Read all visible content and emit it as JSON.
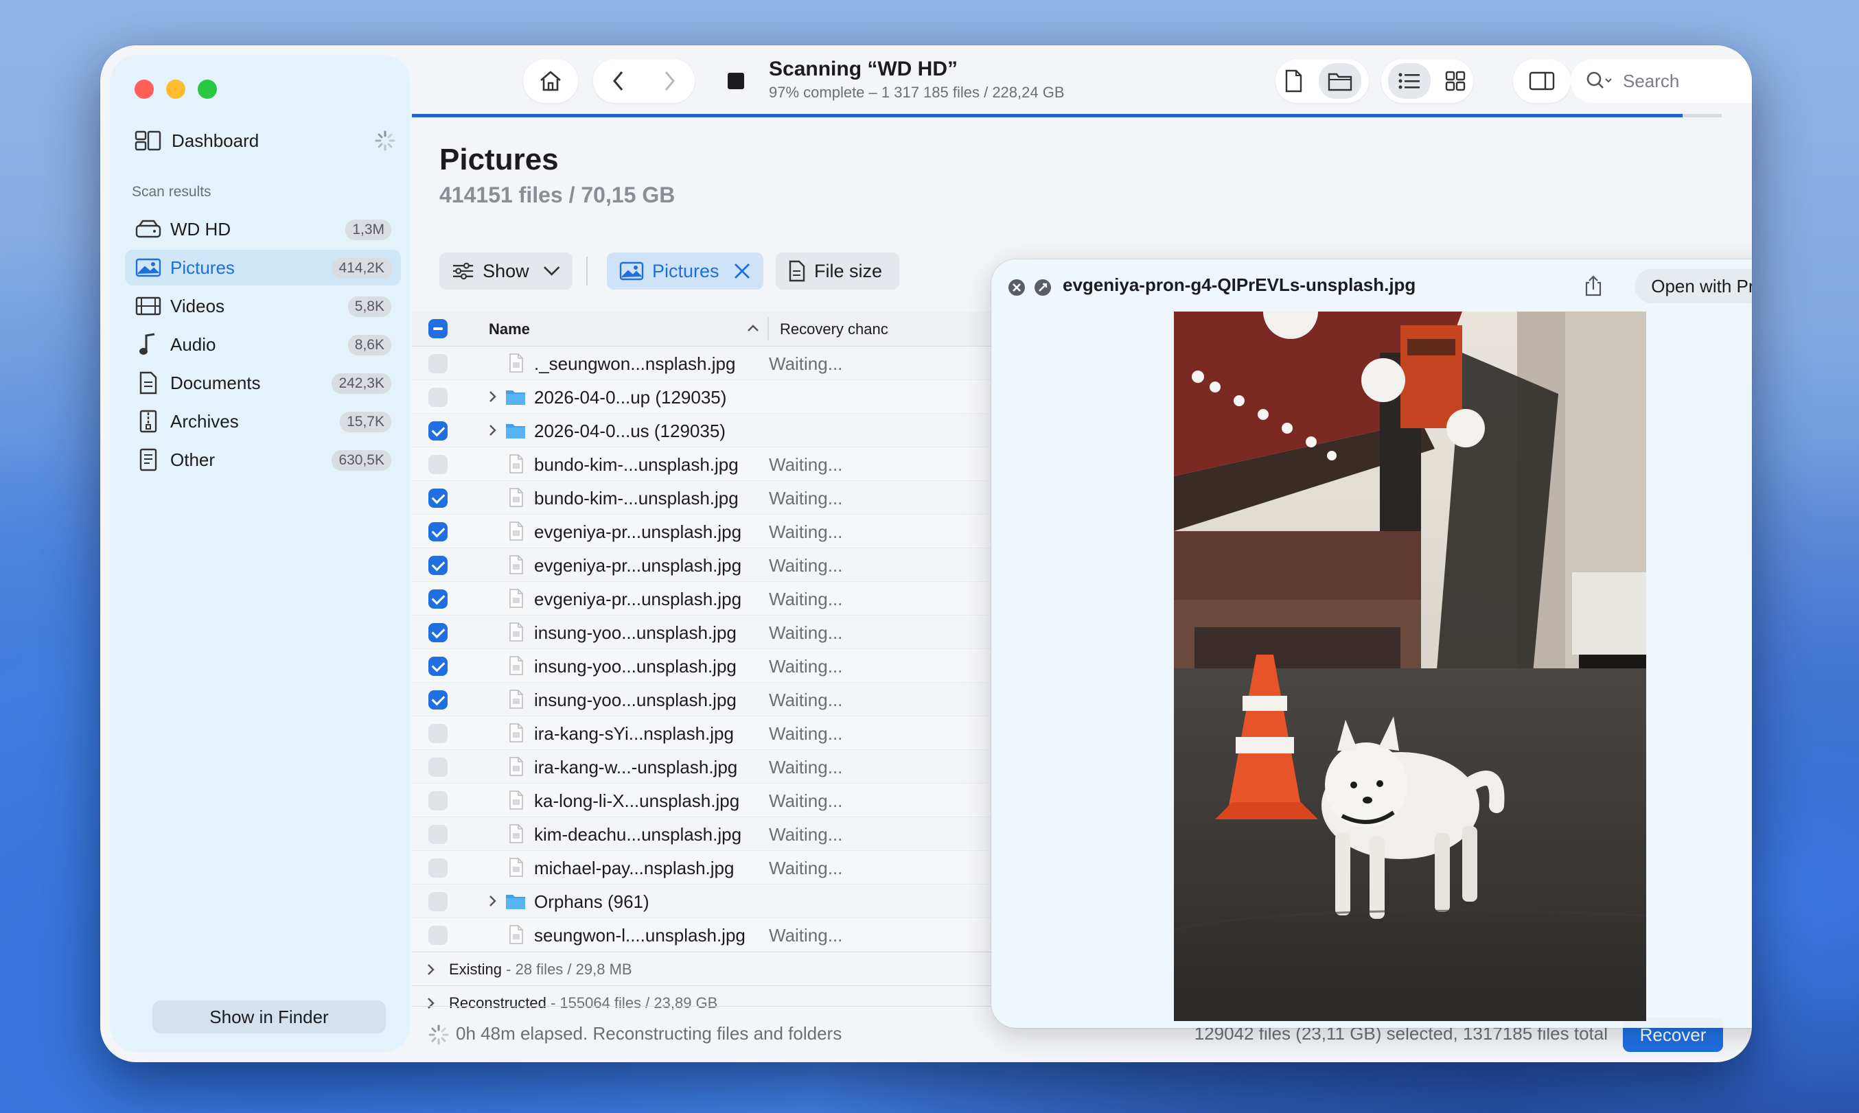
{
  "window": {
    "sidebar": {
      "dashboard_label": "Dashboard",
      "section_label": "Scan results",
      "items": [
        {
          "label": "WD HD",
          "count": "1,3M",
          "icon": "hard-drive-icon",
          "active": false
        },
        {
          "label": "Pictures",
          "count": "414,2K",
          "icon": "image-icon",
          "active": true
        },
        {
          "label": "Videos",
          "count": "5,8K",
          "icon": "film-icon",
          "active": false
        },
        {
          "label": "Audio",
          "count": "8,6K",
          "icon": "music-note-icon",
          "active": false
        },
        {
          "label": "Documents",
          "count": "242,3K",
          "icon": "document-icon",
          "active": false
        },
        {
          "label": "Archives",
          "count": "15,7K",
          "icon": "archive-icon",
          "active": false
        },
        {
          "label": "Other",
          "count": "630,5K",
          "icon": "other-file-icon",
          "active": false
        }
      ],
      "show_in_finder": "Show in Finder"
    },
    "toolbar": {
      "scan_title": "Scanning “WD HD”",
      "scan_subtitle": "97% complete – 1 317 185 files / 228,24 GB",
      "progress": 0.97,
      "search_placeholder": "Search"
    },
    "content": {
      "title": "Pictures",
      "subtitle": "414151 files / 70,15 GB",
      "filters": {
        "show_label": "Show",
        "pictures_label": "Pictures",
        "filesize_label": "File size"
      },
      "columns": {
        "name": "Name",
        "recovery": "Recovery chanc"
      },
      "rows": [
        {
          "type": "file",
          "name": "._seungwon...nsplash.jpg",
          "status": "Waiting...",
          "checked": false
        },
        {
          "type": "folder",
          "name": "2026-04-0...up (129035)",
          "status": "",
          "checked": false
        },
        {
          "type": "folder",
          "name": "2026-04-0...us (129035)",
          "status": "",
          "checked": true
        },
        {
          "type": "file",
          "name": "bundo-kim-...unsplash.jpg",
          "status": "Waiting...",
          "checked": false
        },
        {
          "type": "file",
          "name": "bundo-kim-...unsplash.jpg",
          "status": "Waiting...",
          "checked": true
        },
        {
          "type": "file",
          "name": "evgeniya-pr...unsplash.jpg",
          "status": "Waiting...",
          "checked": true
        },
        {
          "type": "file",
          "name": "evgeniya-pr...unsplash.jpg",
          "status": "Waiting...",
          "checked": true
        },
        {
          "type": "file",
          "name": "evgeniya-pr...unsplash.jpg",
          "status": "Waiting...",
          "checked": true
        },
        {
          "type": "file",
          "name": "insung-yoo...unsplash.jpg",
          "status": "Waiting...",
          "checked": true
        },
        {
          "type": "file",
          "name": "insung-yoo...unsplash.jpg",
          "status": "Waiting...",
          "checked": true
        },
        {
          "type": "file",
          "name": "insung-yoo...unsplash.jpg",
          "status": "Waiting...",
          "checked": true
        },
        {
          "type": "file",
          "name": "ira-kang-sYi...nsplash.jpg",
          "status": "Waiting...",
          "checked": false
        },
        {
          "type": "file",
          "name": "ira-kang-w...-unsplash.jpg",
          "status": "Waiting...",
          "checked": false
        },
        {
          "type": "file",
          "name": "ka-long-li-X...unsplash.jpg",
          "status": "Waiting...",
          "checked": false
        },
        {
          "type": "file",
          "name": "kim-deachu...unsplash.jpg",
          "status": "Waiting...",
          "checked": false
        },
        {
          "type": "file",
          "name": "michael-pay...nsplash.jpg",
          "status": "Waiting...",
          "checked": false
        },
        {
          "type": "folder",
          "name": "Orphans (961)",
          "status": "",
          "checked": false
        },
        {
          "type": "file",
          "name": "seungwon-l....unsplash.jpg",
          "status": "Waiting...",
          "checked": false
        }
      ],
      "groups": [
        {
          "label": "Existing",
          "detail": " - 28 files / 29,8 MB"
        },
        {
          "label": "Reconstructed",
          "detail": " - 155064 files / 23,89 GB"
        }
      ]
    },
    "footer": {
      "elapsed": "0h 48m elapsed. Reconstructing files and folders",
      "selection": "129042 files (23,11 GB) selected, 1317185 files total",
      "recover_label": "Recover"
    },
    "preview": {
      "filename": "evgeniya-pron-g4-QIPrEVLs-unsplash.jpg",
      "open_with": "Open with Preview"
    }
  },
  "colors": {
    "accent": "#1f6fe0",
    "sidebar_bg": "#e4f3fb"
  }
}
